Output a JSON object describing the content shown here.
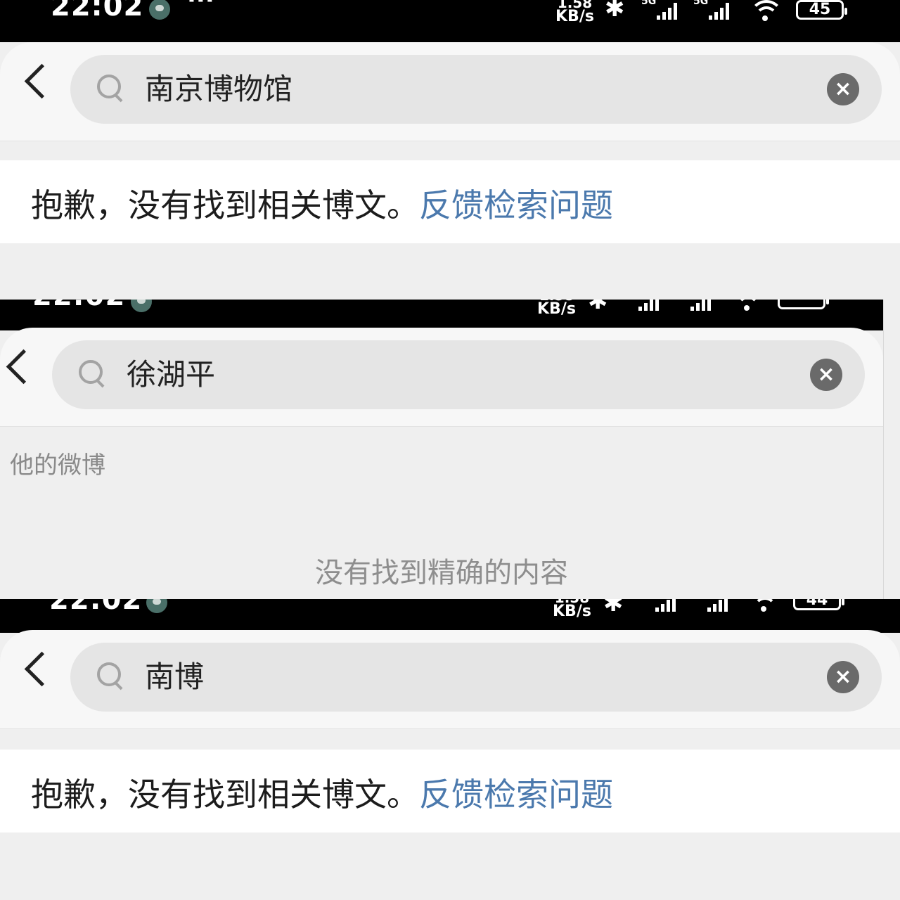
{
  "status_bar": {
    "time": "22:02",
    "network_speed_value": "1.58",
    "network_speed_unit": "KB/s",
    "network_tag": "5G",
    "battery": "45",
    "battery_2": "44"
  },
  "screens": [
    {
      "search_query": "南京博物馆",
      "notice_text": "抱歉，没有找到相关博文。",
      "feedback_link": "反馈检索问题"
    },
    {
      "search_query": "徐湖平",
      "section_label": "他的微博",
      "empty_text": "没有找到精确的内容"
    },
    {
      "search_query": "南博",
      "notice_text": "抱歉，没有找到相关博文。",
      "feedback_link": "反馈检索问题"
    }
  ],
  "icons": [
    "chevron-left-icon",
    "search-icon",
    "clear-icon",
    "bluetooth-icon",
    "signal-icon",
    "wifi-icon",
    "battery-icon"
  ]
}
